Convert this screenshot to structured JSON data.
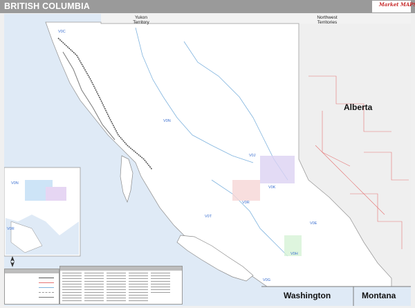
{
  "header": {
    "title": "BRITISH COLUMBIA",
    "publisher_logo": "Market MAPS"
  },
  "map": {
    "territories": {
      "yukon": "Yukon\nTerritory",
      "northwest": "Northwest\nTerritories"
    },
    "neighbors": {
      "alberta": "Alberta",
      "washington": "Washington",
      "montana": "Montana"
    },
    "postal_labels": [
      "V0C",
      "V0J",
      "V0E",
      "V0H",
      "V0K",
      "V0G",
      "V0N",
      "V0R",
      "V0T"
    ],
    "colors": {
      "ocean": "#dfeaf6",
      "land": "#ffffff",
      "neighbor_land": "#efefef",
      "roads": "#e57373",
      "water": "#7fb3de",
      "postal_label": "#3a6fd0",
      "title_bar": "#9a9a9a"
    },
    "icons": [
      "compass-icon"
    ]
  },
  "inset": {
    "labels": [
      "V0N",
      "V0R"
    ]
  },
  "legend": {
    "heading": "",
    "rows": []
  },
  "index": {
    "heading": ""
  }
}
